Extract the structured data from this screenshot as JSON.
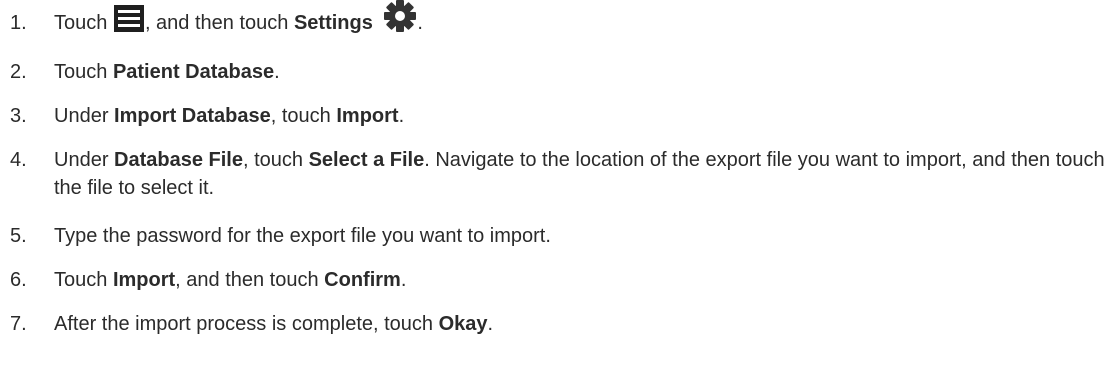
{
  "steps": [
    {
      "number": "1.",
      "segments": [
        {
          "type": "text",
          "text": "Touch "
        },
        {
          "type": "icon",
          "icon": "menu-icon"
        },
        {
          "type": "text",
          "text": ", and then touch "
        },
        {
          "type": "bold",
          "text": "Settings"
        },
        {
          "type": "text",
          "text": " "
        },
        {
          "type": "icon",
          "icon": "gear-icon"
        },
        {
          "type": "text",
          "text": "."
        }
      ]
    },
    {
      "number": "2.",
      "segments": [
        {
          "type": "text",
          "text": "Touch "
        },
        {
          "type": "bold",
          "text": "Patient Database"
        },
        {
          "type": "text",
          "text": "."
        }
      ]
    },
    {
      "number": "3.",
      "segments": [
        {
          "type": "text",
          "text": "Under "
        },
        {
          "type": "bold",
          "text": "Import Database"
        },
        {
          "type": "text",
          "text": ", touch "
        },
        {
          "type": "bold",
          "text": "Import"
        },
        {
          "type": "text",
          "text": "."
        }
      ]
    },
    {
      "number": "4.",
      "segments": [
        {
          "type": "text",
          "text": "Under "
        },
        {
          "type": "bold",
          "text": "Database File"
        },
        {
          "type": "text",
          "text": ", touch "
        },
        {
          "type": "bold",
          "text": "Select a File"
        },
        {
          "type": "text",
          "text": ". Navigate to the location of the export file you want to import, and then touch the file to select it."
        }
      ]
    },
    {
      "number": "5.",
      "segments": [
        {
          "type": "text",
          "text": "Type the password for the export file you want to import."
        }
      ]
    },
    {
      "number": "6.",
      "segments": [
        {
          "type": "text",
          "text": "Touch "
        },
        {
          "type": "bold",
          "text": "Import"
        },
        {
          "type": "text",
          "text": ", and then touch "
        },
        {
          "type": "bold",
          "text": "Confirm"
        },
        {
          "type": "text",
          "text": "."
        }
      ]
    },
    {
      "number": "7.",
      "segments": [
        {
          "type": "text",
          "text": "After the import process is complete, touch "
        },
        {
          "type": "bold",
          "text": "Okay"
        },
        {
          "type": "text",
          "text": "."
        }
      ]
    }
  ]
}
